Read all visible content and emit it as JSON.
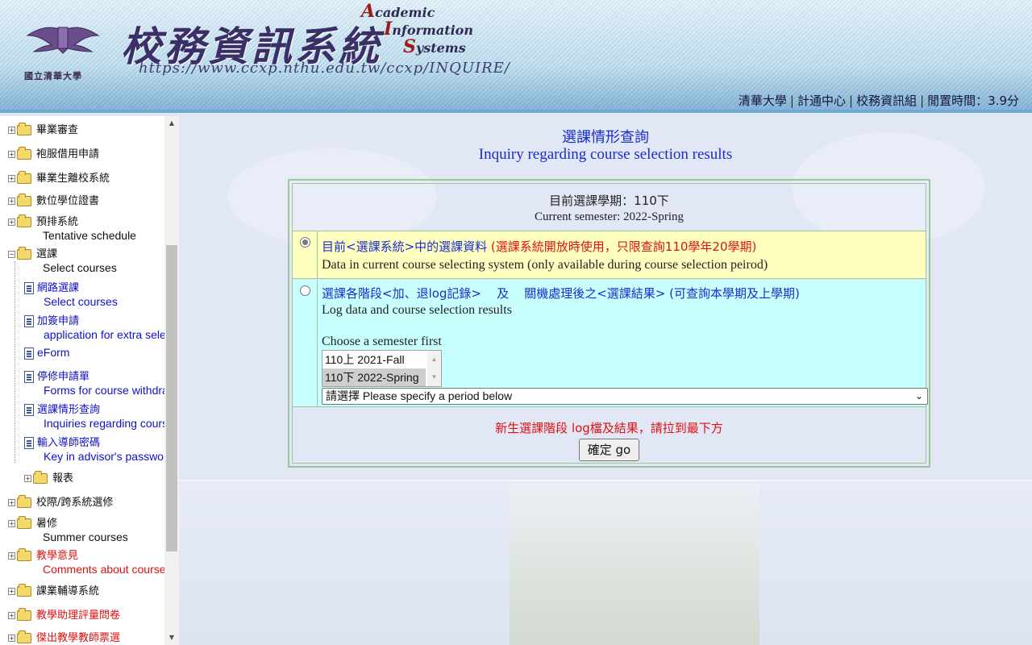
{
  "header": {
    "school_name": "國立清華大學",
    "title_cn": "校務資訊系統",
    "title_en_line1": "cademic",
    "title_en_line1_cap": "A",
    "title_en_line2": "nformation",
    "title_en_line2_cap": "I",
    "title_en_line3": "ystems",
    "title_en_line3_cap": "S",
    "url": "https://www.ccxp.nthu.edu.tw/ccxp/INQUIRE/",
    "links": [
      "清華大學",
      "計通中心",
      "校務資訊組"
    ],
    "idle_time": "閒置時間：3.9分"
  },
  "sidebar": {
    "items": [
      {
        "label": "畢業審查"
      },
      {
        "label": "袍服借用申請"
      },
      {
        "label": "畢業生離校系統"
      },
      {
        "label": "數位學位證書"
      },
      {
        "label": "預排系統",
        "sub": "Tentative schedule"
      },
      {
        "label": "選課",
        "sub": "Select courses"
      },
      {
        "label": "網路選課",
        "sub": "Select courses"
      },
      {
        "label": "加簽申請",
        "sub": "application for extra sele"
      },
      {
        "label": "eForm"
      },
      {
        "label": "停修申請單",
        "sub": "Forms for course withdra"
      },
      {
        "label": "選課情形查詢",
        "sub": "Inquiries regarding cours"
      },
      {
        "label": "輸入導師密碼",
        "sub": "Key in advisor's passwor"
      },
      {
        "label": "報表"
      },
      {
        "label": "校際/跨系統選修"
      },
      {
        "label": "暑修",
        "sub": "Summer courses"
      },
      {
        "label": "教學意見",
        "sub": "Comments about courses"
      },
      {
        "label": "課業輔導系統"
      },
      {
        "label": "教學助理評量問卷"
      },
      {
        "label": "傑出教學教師票選"
      }
    ]
  },
  "main": {
    "title_cn": "選課情形查詢",
    "title_en": "Inquiry regarding course selection results",
    "current_semester_cn": "目前選課學期：110下",
    "current_semester_en": "Current semester: 2022-Spring",
    "option1": {
      "prefix": "目前<選課系統>中的選課資料",
      "note": "(選課系統開放時使用，只限查詢110學年20學期)",
      "en": "Data in current course selecting system (only available during course selection peirod)",
      "checked": true
    },
    "option2": {
      "part1": "選課各階段<加、退log記錄>",
      "part2": "及",
      "part3": "關機處理後之<選課結果>",
      "part4": "(可查詢本學期及上學期)",
      "en": "Log data and course selection results",
      "choose_label": "Choose a semester first",
      "semesters": [
        "110上 2021-Fall",
        "110下 2022-Spring"
      ],
      "selected_semester": "110下 2022-Spring",
      "period_select_value": "請選擇 Please specify a period below",
      "checked": false
    },
    "freshman_note": "新生選課階段 log檔及結果，請拉到最下方",
    "go_button": "確定 go"
  },
  "colors": {
    "accent_blue": "#1a2ccf",
    "alert_red": "#e01010",
    "option1_bg": "#ffffc0",
    "option2_bg": "#c8ffff"
  }
}
